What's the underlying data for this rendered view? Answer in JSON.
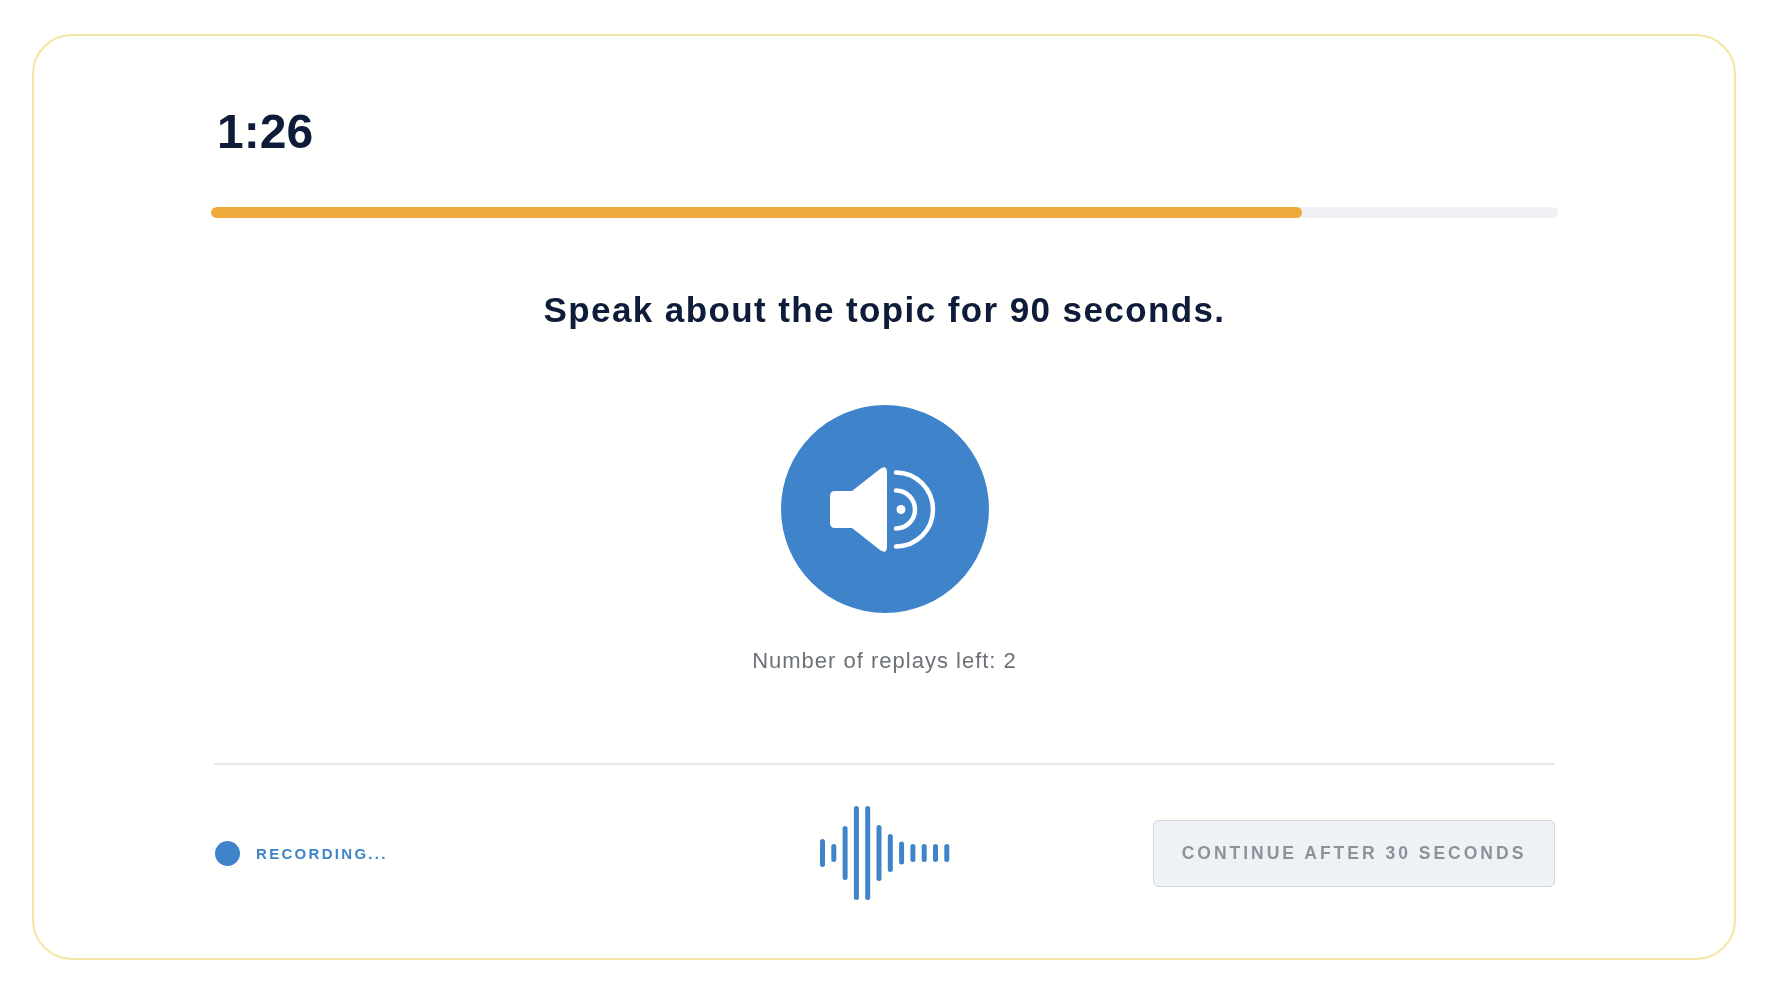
{
  "timer": "1:26",
  "progress": {
    "level": 0.81
  },
  "prompt": "Speak about the topic for 90 seconds.",
  "audio": {
    "replays_left": "Number of replays left: 2"
  },
  "recording": {
    "status": "RECORDING..."
  },
  "continue_button": {
    "label": "CONTINUE AFTER 30 SECONDS",
    "disabled": true
  }
}
